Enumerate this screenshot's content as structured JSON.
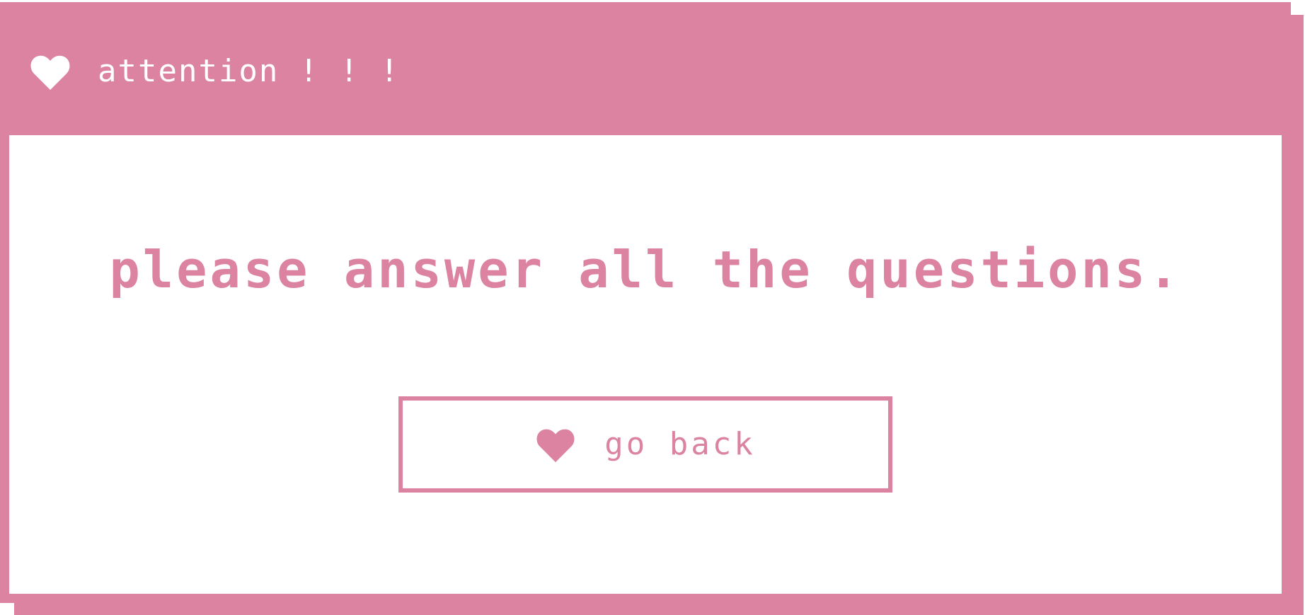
{
  "colors": {
    "accent": "#db83a1",
    "background": "#ffffff",
    "title_text": "#ffffff"
  },
  "dialog": {
    "title_icon": "heart-icon",
    "title": "attention ! ! !",
    "message": "please answer all the questions.",
    "button": {
      "icon": "heart-icon",
      "label": "go back"
    }
  }
}
